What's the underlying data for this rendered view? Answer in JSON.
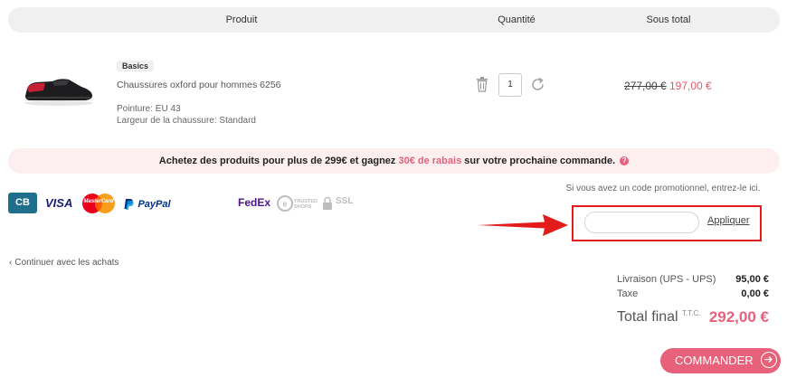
{
  "table": {
    "col_product": "Produit",
    "col_quantity": "Quantité",
    "col_subtotal": "Sous total"
  },
  "product": {
    "badge": "Basics",
    "name": "Chaussures oxford pour hommes 6256",
    "toe": "Pointure: EU 43",
    "width": "Largeur de la chaussure: Standard",
    "quantity": "1",
    "old_price": "277,00 €",
    "new_price": "197,00 €"
  },
  "promo_banner": {
    "text_before": "Achetez des produits pour plus de 299€ et gagnez ",
    "highlight": "30€ de rabais",
    "text_after": " sur votre prochaine commande.",
    "info_icon": "?"
  },
  "payment_logos": {
    "cb": "CB",
    "visa": "VISA",
    "mastercard": "MasterCard",
    "paypal": "PayPal",
    "fedex": "FedEx",
    "trusted_shops": "TRUSTED SHOPS",
    "ssl": "SSL"
  },
  "promo_code": {
    "prompt": "Si vous avez un code promotionnel, entrez-le ici.",
    "input_value": "",
    "apply_label": "Appliquer"
  },
  "continue_link": "Continuer avec les achats",
  "totals": {
    "shipping_label": "Livraison (UPS - UPS)",
    "shipping_value": "95,00 €",
    "tax_label": "Taxe",
    "tax_value": "0,00 €",
    "final_label": "Total final",
    "final_suffix": "T.T.C.",
    "final_value": "292,00 €"
  },
  "order_button": "COMMANDER",
  "colors": {
    "accent": "#e8617a",
    "annotation_red": "#e21b1b"
  }
}
